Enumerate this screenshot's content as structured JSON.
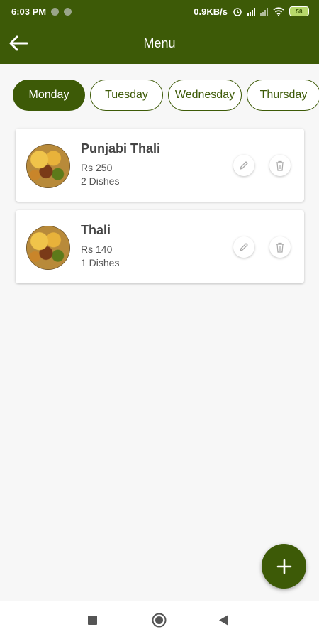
{
  "status_bar": {
    "time": "6:03 PM",
    "speed": "0.9KB/s",
    "battery": "58"
  },
  "app_bar": {
    "title": "Menu",
    "back_icon": "arrow-left-icon"
  },
  "days": [
    {
      "label": "Monday",
      "selected": true
    },
    {
      "label": "Tuesday",
      "selected": false
    },
    {
      "label": "Wednesday",
      "selected": false
    },
    {
      "label": "Thursday",
      "selected": false
    }
  ],
  "menu_items": [
    {
      "name": "Punjabi Thali",
      "price": "Rs 250",
      "dishes": "2 Dishes"
    },
    {
      "name": "Thali",
      "price": "Rs 140",
      "dishes": "1 Dishes"
    }
  ],
  "fab": {
    "icon": "plus-icon"
  },
  "nav": {
    "recents_icon": "square-icon",
    "home_icon": "circle-icon",
    "back_icon": "triangle-back-icon"
  },
  "colors": {
    "primary": "#3d5a07",
    "background": "#f7f7f7"
  }
}
